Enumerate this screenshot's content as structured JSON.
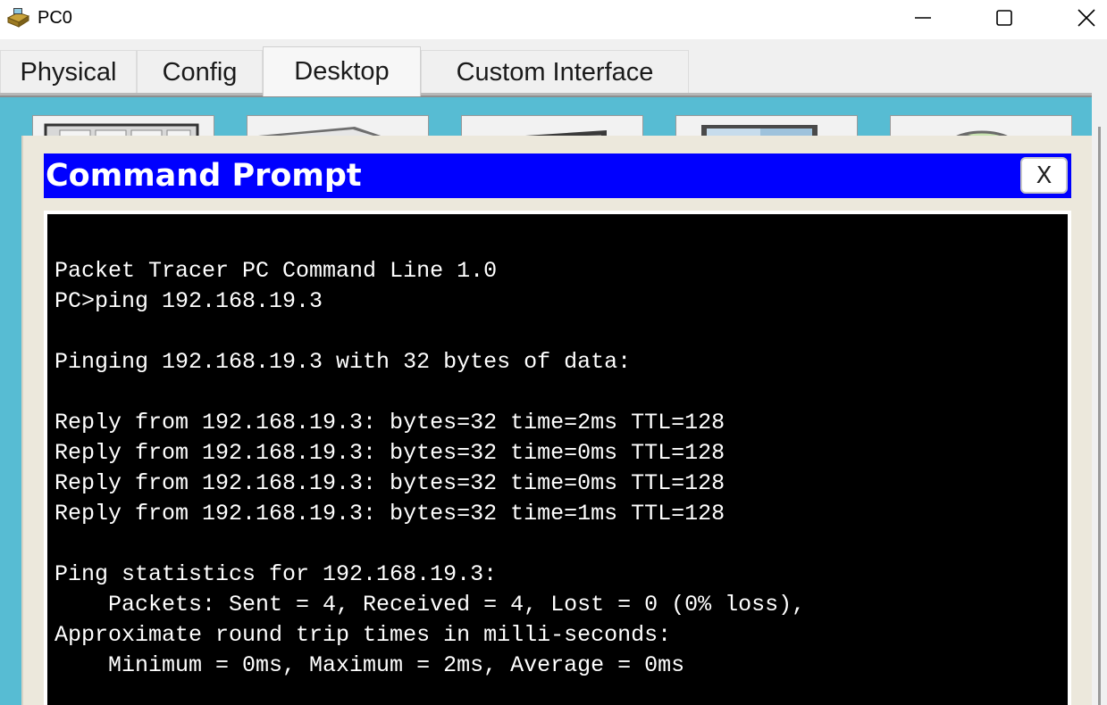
{
  "window": {
    "title": "PC0",
    "controls": [
      "minimize",
      "maximize",
      "close"
    ]
  },
  "tabs": [
    {
      "label": "Physical",
      "active": false
    },
    {
      "label": "Config",
      "active": false
    },
    {
      "label": "Desktop",
      "active": true
    },
    {
      "label": "Custom Interface",
      "active": false
    }
  ],
  "command_prompt": {
    "title": "Command Prompt",
    "close_label": "X",
    "lines": [
      "Packet Tracer PC Command Line 1.0",
      "PC>ping 192.168.19.3",
      "",
      "Pinging 192.168.19.3 with 32 bytes of data:",
      "",
      "Reply from 192.168.19.3: bytes=32 time=2ms TTL=128",
      "Reply from 192.168.19.3: bytes=32 time=0ms TTL=128",
      "Reply from 192.168.19.3: bytes=32 time=0ms TTL=128",
      "Reply from 192.168.19.3: bytes=32 time=1ms TTL=128",
      "",
      "Ping statistics for 192.168.19.3:",
      "    Packets: Sent = 4, Received = 4, Lost = 0 (0% loss),",
      "Approximate round trip times in milli-seconds:",
      "    Minimum = 0ms, Maximum = 2ms, Average = 0ms"
    ]
  },
  "colors": {
    "desktop_background": "#57bcd3",
    "prompt_title_bar": "#0000ff",
    "terminal_background": "#000000",
    "terminal_text": "#ffffff"
  }
}
